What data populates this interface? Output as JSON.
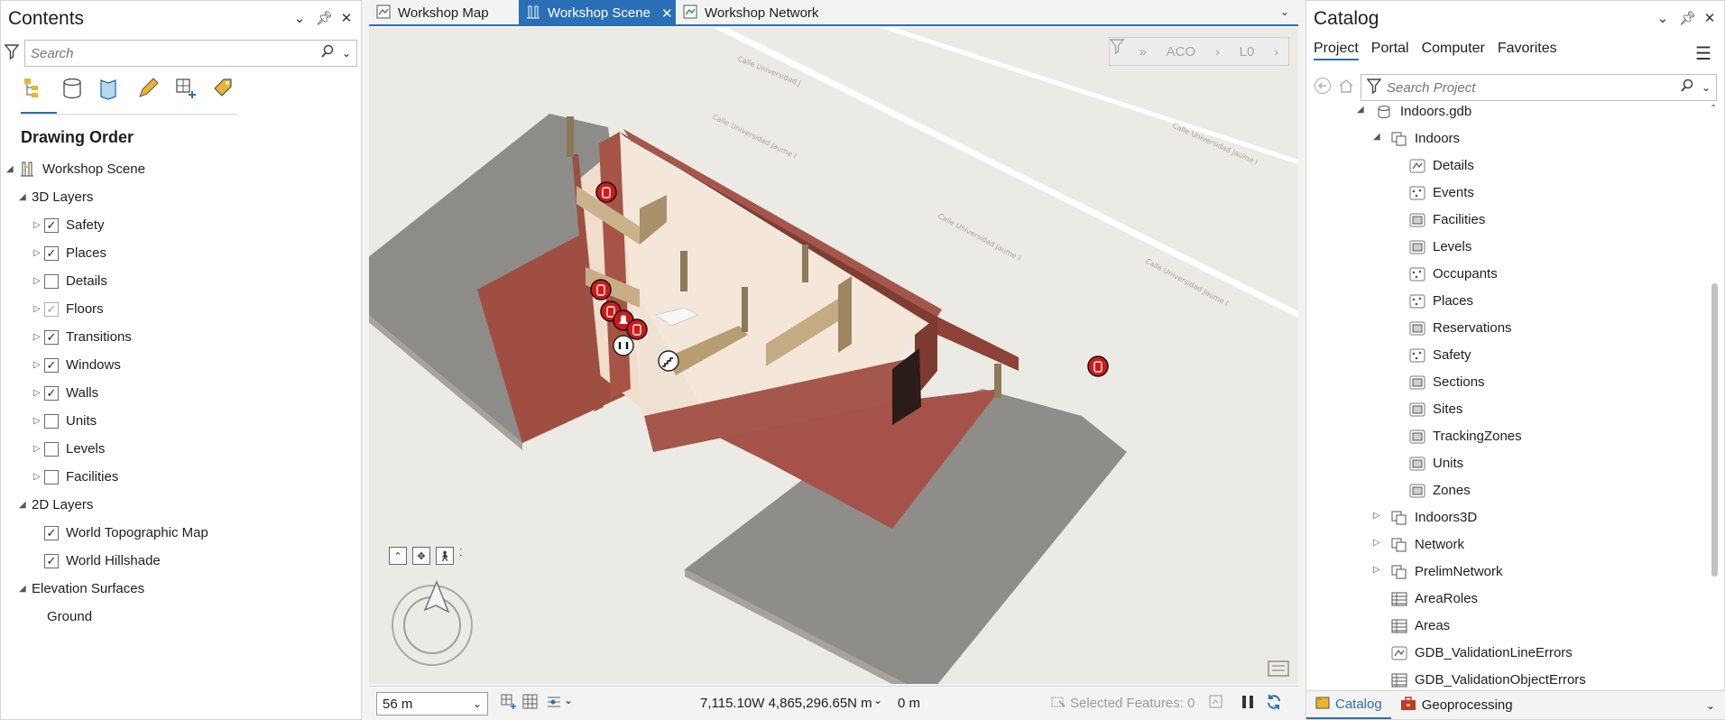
{
  "contents": {
    "title": "Contents",
    "search_placeholder": "Search",
    "drawing_order": "Drawing Order",
    "scene": "Workshop Scene",
    "groups": [
      {
        "label": "3D Layers",
        "layers": [
          {
            "label": "Safety",
            "checked": true
          },
          {
            "label": "Places",
            "checked": true
          },
          {
            "label": "Details",
            "checked": false
          },
          {
            "label": "Floors",
            "checked": true,
            "dim": true
          },
          {
            "label": "Transitions",
            "checked": true
          },
          {
            "label": "Windows",
            "checked": true
          },
          {
            "label": "Walls",
            "checked": true
          },
          {
            "label": "Units",
            "checked": false
          },
          {
            "label": "Levels",
            "checked": false
          },
          {
            "label": "Facilities",
            "checked": false
          }
        ]
      },
      {
        "label": "2D Layers",
        "layers": [
          {
            "label": "World Topographic Map",
            "checked": true
          },
          {
            "label": "World Hillshade",
            "checked": true
          }
        ]
      },
      {
        "label": "Elevation Surfaces",
        "layers": [
          {
            "label": "Ground"
          }
        ]
      }
    ]
  },
  "tabs": [
    {
      "label": "Workshop Map",
      "active": false
    },
    {
      "label": "Workshop Scene",
      "active": true
    },
    {
      "label": "Workshop Network",
      "active": false
    }
  ],
  "scene": {
    "filter": {
      "aco": "ACO",
      "level": "L0"
    },
    "streets": [
      "Calle Universidad J",
      "Calle Universidad Jaume I",
      "Calle Universidad Jaume I",
      "Calle Universidad Jaume I",
      "Calle Universidad Jaume I"
    ]
  },
  "status": {
    "scale": "56 m",
    "coords": "7,115.10W 4,865,296.65N m",
    "elevation": "0 m",
    "selected": "Selected Features: 0"
  },
  "catalog": {
    "title": "Catalog",
    "tabs": [
      "Project",
      "Portal",
      "Computer",
      "Favorites"
    ],
    "active_tab": "Project",
    "search_placeholder": "Search Project",
    "items": [
      {
        "label": "Indoors.gdb",
        "level": 0,
        "icon": "gdb-icon",
        "expand": "open"
      },
      {
        "label": "Indoors",
        "level": 1,
        "icon": "dataset-icon",
        "expand": "open"
      },
      {
        "label": "Details",
        "level": 2,
        "icon": "line-fc-icon"
      },
      {
        "label": "Events",
        "level": 2,
        "icon": "point-fc-icon"
      },
      {
        "label": "Facilities",
        "level": 2,
        "icon": "polygon-fc-icon"
      },
      {
        "label": "Levels",
        "level": 2,
        "icon": "polygon-fc-icon"
      },
      {
        "label": "Occupants",
        "level": 2,
        "icon": "point-fc-icon"
      },
      {
        "label": "Places",
        "level": 2,
        "icon": "point-fc-icon"
      },
      {
        "label": "Reservations",
        "level": 2,
        "icon": "polygon-fc-icon"
      },
      {
        "label": "Safety",
        "level": 2,
        "icon": "point-fc-icon"
      },
      {
        "label": "Sections",
        "level": 2,
        "icon": "polygon-fc-icon"
      },
      {
        "label": "Sites",
        "level": 2,
        "icon": "polygon-fc-icon"
      },
      {
        "label": "TrackingZones",
        "level": 2,
        "icon": "polygon-fc-icon"
      },
      {
        "label": "Units",
        "level": 2,
        "icon": "polygon-fc-icon"
      },
      {
        "label": "Zones",
        "level": 2,
        "icon": "polygon-fc-icon"
      },
      {
        "label": "Indoors3D",
        "level": 1,
        "icon": "dataset-icon",
        "expand": "closed"
      },
      {
        "label": "Network",
        "level": 1,
        "icon": "dataset-icon",
        "expand": "closed"
      },
      {
        "label": "PrelimNetwork",
        "level": 1,
        "icon": "dataset-icon",
        "expand": "closed"
      },
      {
        "label": "AreaRoles",
        "level": 1,
        "icon": "table-icon",
        "flat": true
      },
      {
        "label": "Areas",
        "level": 1,
        "icon": "table-icon",
        "flat": true
      },
      {
        "label": "GDB_ValidationLineErrors",
        "level": 1,
        "icon": "line-fc-icon",
        "flat": true
      },
      {
        "label": "GDB_ValidationObjectErrors",
        "level": 1,
        "icon": "table-icon",
        "flat": true
      }
    ],
    "bottom_tabs": [
      "Catalog",
      "Geoprocessing"
    ]
  }
}
